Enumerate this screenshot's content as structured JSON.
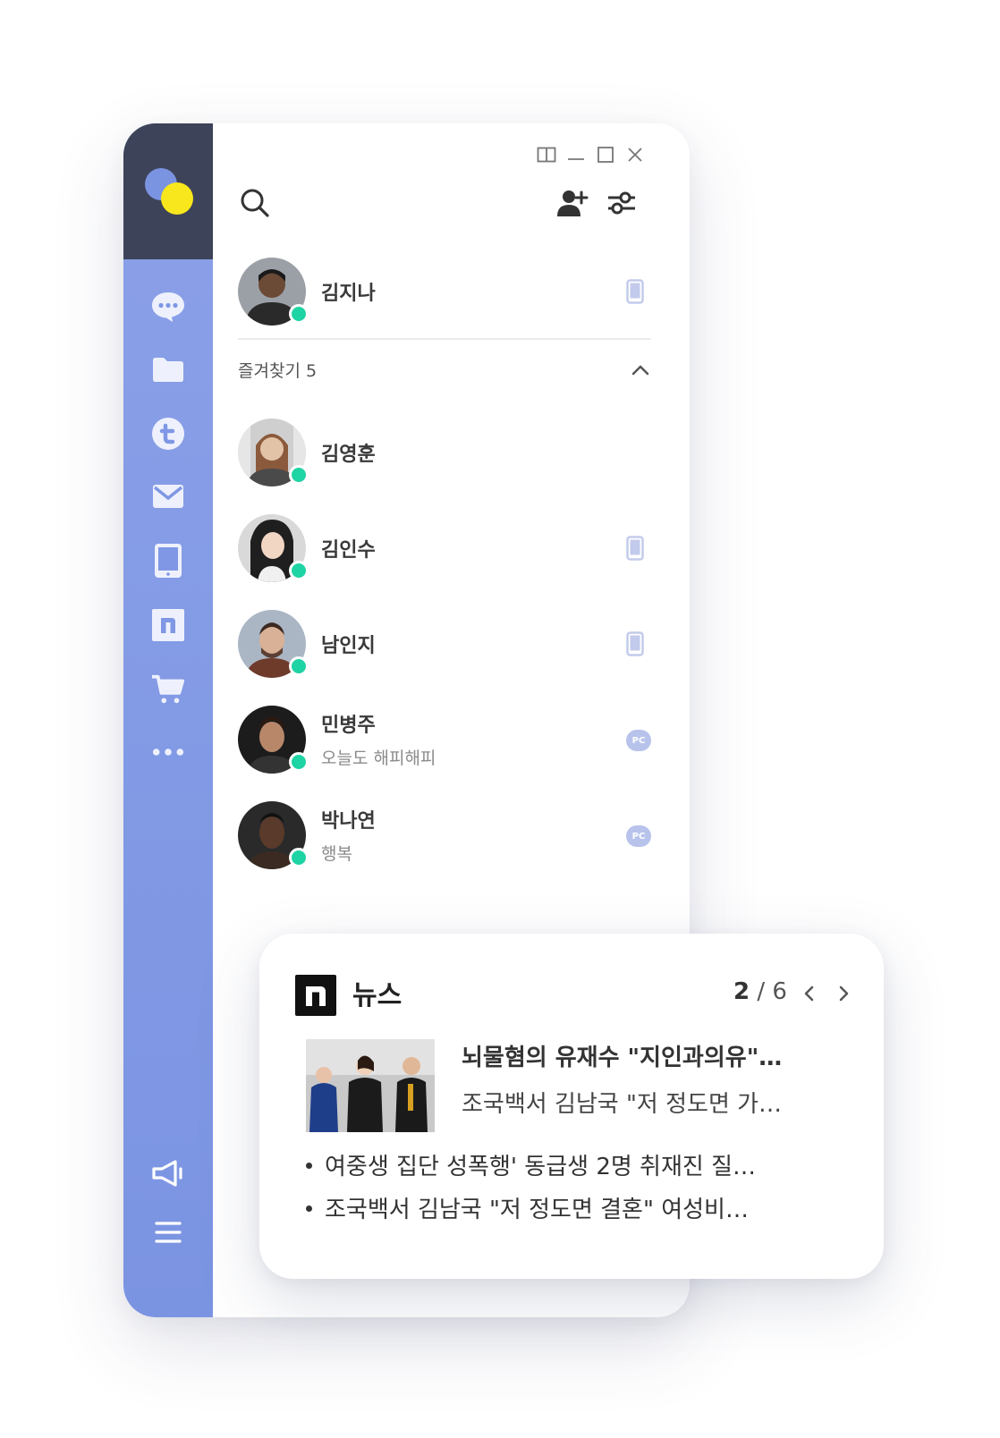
{
  "colors": {
    "sidebar_top": "#3d4358",
    "sidebar": "#7b94e2",
    "icon_light": "#eef1fd",
    "online": "#1ed3a4",
    "accent_yellow": "#f8e71c"
  },
  "nav_icons": [
    "chat-icon",
    "folder-icon",
    "t-icon",
    "mail-icon",
    "tablet-icon",
    "n-icon",
    "cart-icon",
    "more-icon"
  ],
  "bottom_icons": [
    "megaphone-icon",
    "menu-icon"
  ],
  "window_controls": [
    "split-view-icon",
    "minimize-icon",
    "maximize-icon",
    "close-icon"
  ],
  "toolbar": [
    "search-icon",
    "add-friend-icon",
    "filter-icon"
  ],
  "my_profile": {
    "name": "김지나",
    "device": "mobile"
  },
  "favorites": {
    "title": "즐겨찾기 5",
    "items": [
      {
        "name": "김영훈",
        "status": "",
        "device": ""
      },
      {
        "name": "김인수",
        "status": "",
        "device": "mobile"
      },
      {
        "name": "남인지",
        "status": "",
        "device": "mobile"
      },
      {
        "name": "민병주",
        "status": "오늘도 해피해피",
        "device": "pc"
      },
      {
        "name": "박나연",
        "status": "행복",
        "device": "pc"
      }
    ]
  },
  "pc_badge": "PC",
  "news": {
    "title": "뉴스",
    "page_current": "2",
    "page_total": "6",
    "headline": "뇌물혐의 유재수 \"지인과의유\"…",
    "subline": "조국백서 김남국 \"저 정도면 가…",
    "bullets": [
      "여중생 집단 성폭행' 동급생 2명 취재진 질…",
      "조국백서 김남국 \"저 정도면 결혼\" 여성비…"
    ]
  }
}
